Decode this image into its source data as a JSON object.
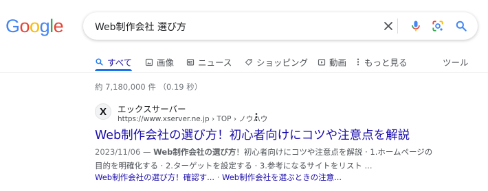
{
  "logo": {
    "text": "Google",
    "letters": [
      {
        "ch": "G",
        "color": "#4285f4"
      },
      {
        "ch": "o",
        "color": "#ea4335"
      },
      {
        "ch": "o",
        "color": "#fbbc05"
      },
      {
        "ch": "g",
        "color": "#4285f4"
      },
      {
        "ch": "l",
        "color": "#34a853"
      },
      {
        "ch": "e",
        "color": "#ea4335"
      }
    ]
  },
  "search": {
    "query": "Web制作会社 選び方",
    "icons": [
      "clear-icon",
      "microphone-icon",
      "lens-camera-icon",
      "search-icon"
    ]
  },
  "tabs": [
    {
      "label": "すべて",
      "icon": "search-icon",
      "active": true
    },
    {
      "label": "画像",
      "icon": "image-icon"
    },
    {
      "label": "ニュース",
      "icon": "news-icon"
    },
    {
      "label": "ショッピング",
      "icon": "tag-icon"
    },
    {
      "label": "動画",
      "icon": "video-icon"
    },
    {
      "label": "もっと見る",
      "icon": "more-vert-icon"
    },
    {
      "label": "ツール"
    }
  ],
  "stats": "約 7,180,000 件  （0.19 秒）",
  "result": {
    "favicon": "X",
    "site_name": "エックスサーバー",
    "url": "https://www.xserver.ne.jp › TOP › ノウハウ",
    "title": "Web制作会社の選び方！初心者向けにコツや注意点を解説",
    "date": "2023/11/06",
    "snippet_dash": " — ",
    "snippet_bold": "Web制作会社の選び方",
    "snippet_rest": "！初心者向けにコツや注意点を解説 · 1.ホームページの目的を明確化する · 2.ターゲットを設定する · 3.参考になるサイトをリスト ...",
    "sitelinks": [
      "Web制作会社の選び方！確認す...",
      "Web制作会社を選ぶときの注意..."
    ],
    "sitelink_separator": " · "
  },
  "colors": {
    "link": "#1a0dab",
    "accent_blue": "#1a73e8"
  }
}
